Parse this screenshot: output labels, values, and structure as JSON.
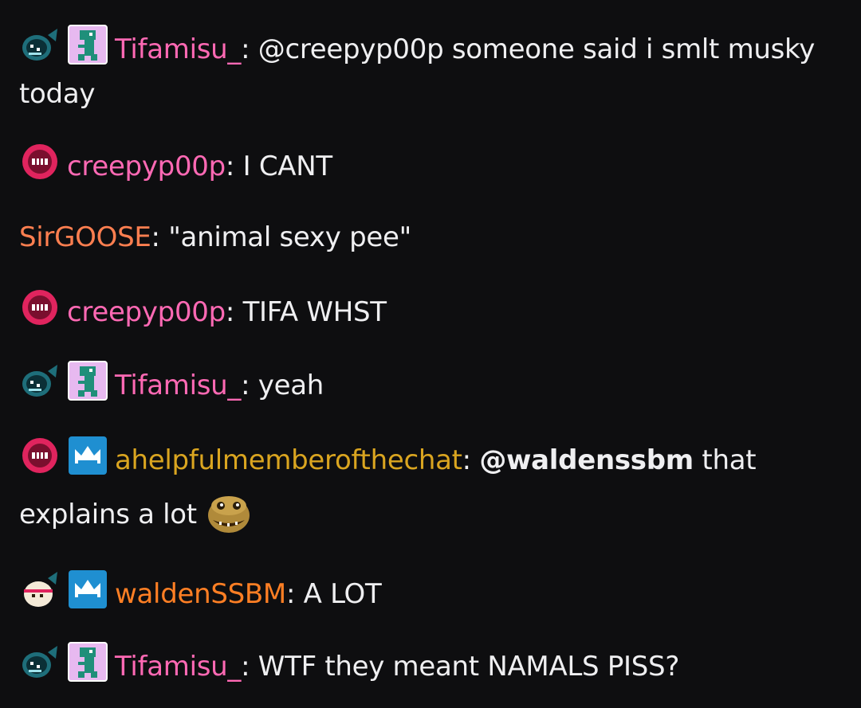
{
  "colors": {
    "background": "#0e0e10",
    "text": "#efeff1",
    "tifamisu": "#ff69b4",
    "creepyp00p": "#ff69b4",
    "sirgoose": "#ff7f50",
    "ahelpful": "#daa520",
    "walden": "#ff7f24"
  },
  "messages": [
    {
      "badges": [
        "fish-badge-icon",
        "dino-badge-icon"
      ],
      "username": "Tifamisu_",
      "parts": [
        "@creepyp00p someone said i smlt musky today"
      ]
    },
    {
      "badges": [
        "red-face-badge-icon"
      ],
      "username": "creepyp00p",
      "parts": [
        "I CANT"
      ]
    },
    {
      "badges": [],
      "username": "SirGOOSE",
      "parts": [
        "\"animal sexy pee\""
      ]
    },
    {
      "badges": [
        "red-face-badge-icon"
      ],
      "username": "creepyp00p",
      "parts": [
        "TIFA WHST"
      ]
    },
    {
      "badges": [
        "fish-badge-icon",
        "dino-badge-icon"
      ],
      "username": "Tifamisu_",
      "parts": [
        "yeah"
      ]
    },
    {
      "badges": [
        "red-face-badge-icon",
        "crown-badge-icon"
      ],
      "username": "ahelpfulmemberofthechat",
      "mention": "@waldenssbm",
      "parts": [
        "that explains a lot"
      ],
      "emote": "lizard-emote-icon"
    },
    {
      "badges": [
        "egg-badge-icon",
        "crown-badge-icon"
      ],
      "username": "waldenSSBM",
      "parts": [
        "A LOT"
      ]
    },
    {
      "badges": [
        "fish-badge-icon",
        "dino-badge-icon"
      ],
      "username": "Tifamisu_",
      "parts": [
        "WTF they meant NAMALS PISS?"
      ]
    }
  ],
  "separator": ": "
}
